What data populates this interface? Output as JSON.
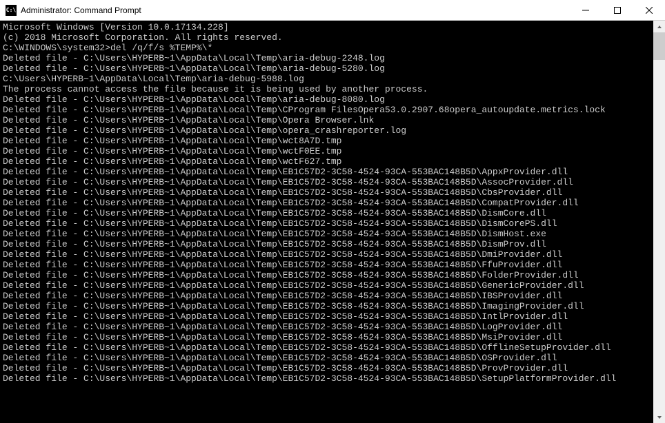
{
  "window": {
    "title": "Administrator: Command Prompt",
    "icon_text": "C:\\"
  },
  "terminal": {
    "lines": [
      "Microsoft Windows [Version 10.0.17134.228]",
      "(c) 2018 Microsoft Corporation. All rights reserved.",
      "",
      "C:\\WINDOWS\\system32>del /q/f/s %TEMP%\\*",
      "Deleted file - C:\\Users\\HYPERB~1\\AppData\\Local\\Temp\\aria-debug-2248.log",
      "Deleted file - C:\\Users\\HYPERB~1\\AppData\\Local\\Temp\\aria-debug-5280.log",
      "C:\\Users\\HYPERB~1\\AppData\\Local\\Temp\\aria-debug-5988.log",
      "The process cannot access the file because it is being used by another process.",
      "Deleted file - C:\\Users\\HYPERB~1\\AppData\\Local\\Temp\\aria-debug-8080.log",
      "Deleted file - C:\\Users\\HYPERB~1\\AppData\\Local\\Temp\\CProgram FilesOpera53.0.2907.68opera_autoupdate.metrics.lock",
      "Deleted file - C:\\Users\\HYPERB~1\\AppData\\Local\\Temp\\Opera Browser.lnk",
      "Deleted file - C:\\Users\\HYPERB~1\\AppData\\Local\\Temp\\opera_crashreporter.log",
      "Deleted file - C:\\Users\\HYPERB~1\\AppData\\Local\\Temp\\wct8A7D.tmp",
      "Deleted file - C:\\Users\\HYPERB~1\\AppData\\Local\\Temp\\wctF0EE.tmp",
      "Deleted file - C:\\Users\\HYPERB~1\\AppData\\Local\\Temp\\wctF627.tmp",
      "Deleted file - C:\\Users\\HYPERB~1\\AppData\\Local\\Temp\\EB1C57D2-3C58-4524-93CA-553BAC148B5D\\AppxProvider.dll",
      "Deleted file - C:\\Users\\HYPERB~1\\AppData\\Local\\Temp\\EB1C57D2-3C58-4524-93CA-553BAC148B5D\\AssocProvider.dll",
      "Deleted file - C:\\Users\\HYPERB~1\\AppData\\Local\\Temp\\EB1C57D2-3C58-4524-93CA-553BAC148B5D\\CbsProvider.dll",
      "Deleted file - C:\\Users\\HYPERB~1\\AppData\\Local\\Temp\\EB1C57D2-3C58-4524-93CA-553BAC148B5D\\CompatProvider.dll",
      "Deleted file - C:\\Users\\HYPERB~1\\AppData\\Local\\Temp\\EB1C57D2-3C58-4524-93CA-553BAC148B5D\\DismCore.dll",
      "Deleted file - C:\\Users\\HYPERB~1\\AppData\\Local\\Temp\\EB1C57D2-3C58-4524-93CA-553BAC148B5D\\DismCorePS.dll",
      "Deleted file - C:\\Users\\HYPERB~1\\AppData\\Local\\Temp\\EB1C57D2-3C58-4524-93CA-553BAC148B5D\\DismHost.exe",
      "Deleted file - C:\\Users\\HYPERB~1\\AppData\\Local\\Temp\\EB1C57D2-3C58-4524-93CA-553BAC148B5D\\DismProv.dll",
      "Deleted file - C:\\Users\\HYPERB~1\\AppData\\Local\\Temp\\EB1C57D2-3C58-4524-93CA-553BAC148B5D\\DmiProvider.dll",
      "Deleted file - C:\\Users\\HYPERB~1\\AppData\\Local\\Temp\\EB1C57D2-3C58-4524-93CA-553BAC148B5D\\FfuProvider.dll",
      "Deleted file - C:\\Users\\HYPERB~1\\AppData\\Local\\Temp\\EB1C57D2-3C58-4524-93CA-553BAC148B5D\\FolderProvider.dll",
      "Deleted file - C:\\Users\\HYPERB~1\\AppData\\Local\\Temp\\EB1C57D2-3C58-4524-93CA-553BAC148B5D\\GenericProvider.dll",
      "Deleted file - C:\\Users\\HYPERB~1\\AppData\\Local\\Temp\\EB1C57D2-3C58-4524-93CA-553BAC148B5D\\IBSProvider.dll",
      "Deleted file - C:\\Users\\HYPERB~1\\AppData\\Local\\Temp\\EB1C57D2-3C58-4524-93CA-553BAC148B5D\\ImagingProvider.dll",
      "Deleted file - C:\\Users\\HYPERB~1\\AppData\\Local\\Temp\\EB1C57D2-3C58-4524-93CA-553BAC148B5D\\IntlProvider.dll",
      "Deleted file - C:\\Users\\HYPERB~1\\AppData\\Local\\Temp\\EB1C57D2-3C58-4524-93CA-553BAC148B5D\\LogProvider.dll",
      "Deleted file - C:\\Users\\HYPERB~1\\AppData\\Local\\Temp\\EB1C57D2-3C58-4524-93CA-553BAC148B5D\\MsiProvider.dll",
      "Deleted file - C:\\Users\\HYPERB~1\\AppData\\Local\\Temp\\EB1C57D2-3C58-4524-93CA-553BAC148B5D\\OfflineSetupProvider.dll",
      "Deleted file - C:\\Users\\HYPERB~1\\AppData\\Local\\Temp\\EB1C57D2-3C58-4524-93CA-553BAC148B5D\\OSProvider.dll",
      "Deleted file - C:\\Users\\HYPERB~1\\AppData\\Local\\Temp\\EB1C57D2-3C58-4524-93CA-553BAC148B5D\\ProvProvider.dll",
      "Deleted file - C:\\Users\\HYPERB~1\\AppData\\Local\\Temp\\EB1C57D2-3C58-4524-93CA-553BAC148B5D\\SetupPlatformProvider.dll"
    ]
  }
}
